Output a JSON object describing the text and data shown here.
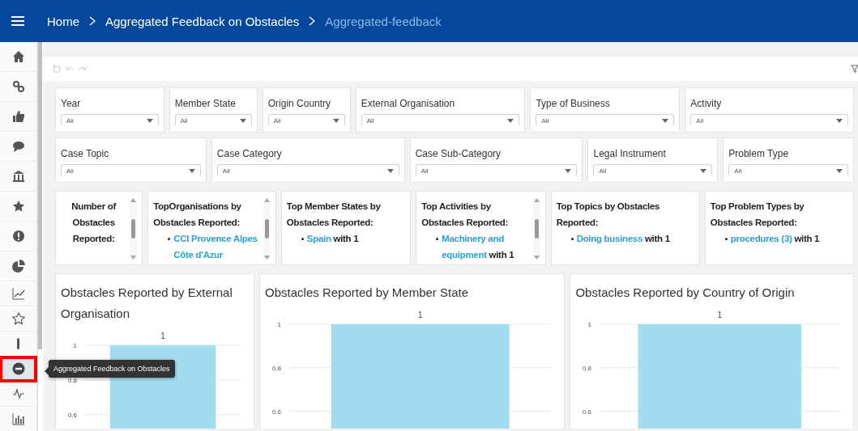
{
  "header": {
    "breadcrumb": [
      {
        "label": "Home",
        "current": false
      },
      {
        "label": "Aggregated Feedback on Obstacles",
        "current": false
      },
      {
        "label": "Aggregated-feedback",
        "current": true
      }
    ]
  },
  "sidebar": {
    "items": [
      {
        "kind": "home",
        "selected": false,
        "highlighted": false
      },
      {
        "kind": "link",
        "selected": false,
        "highlighted": false
      },
      {
        "kind": "thumbs",
        "selected": false,
        "highlighted": false
      },
      {
        "kind": "chat",
        "selected": false,
        "highlighted": false
      },
      {
        "kind": "bank",
        "selected": false,
        "highlighted": false
      },
      {
        "kind": "star",
        "selected": false,
        "highlighted": false
      },
      {
        "kind": "alert",
        "selected": false,
        "highlighted": false
      },
      {
        "kind": "pie",
        "selected": false,
        "highlighted": false
      },
      {
        "kind": "line",
        "selected": false,
        "highlighted": false
      },
      {
        "kind": "star-outline",
        "selected": false,
        "highlighted": false
      },
      {
        "kind": "thermo",
        "selected": false,
        "highlighted": false
      },
      {
        "kind": "minus",
        "selected": true,
        "highlighted": true
      },
      {
        "kind": "pulse",
        "selected": false,
        "highlighted": false
      },
      {
        "kind": "bars",
        "selected": false,
        "highlighted": false
      }
    ],
    "tooltip": "Aggregated Feedback on Obstacles"
  },
  "filters": [
    [
      {
        "label": "Year",
        "value": "All"
      },
      {
        "label": "Member State",
        "value": "All"
      },
      {
        "label": "Origin Country",
        "value": "All"
      },
      {
        "label": "External Organisation",
        "value": "All"
      },
      {
        "label": "Type of Business",
        "value": "All"
      },
      {
        "label": "Activity",
        "value": "All"
      }
    ],
    [
      {
        "label": "Case Topic",
        "value": "All"
      },
      {
        "label": "Case Category",
        "value": "All"
      },
      {
        "label": "Case Sub-Category",
        "value": "All"
      },
      {
        "label": "Legal Instrument",
        "value": "All"
      },
      {
        "label": "Problem Type",
        "value": "All"
      }
    ]
  ],
  "kpis": [
    {
      "kind": "count",
      "title": "Number of Obstacles Reported:",
      "scrollable": true
    },
    {
      "kind": "list",
      "title": "TopOrganisations by Obstacles Reported:",
      "scrollable": true,
      "items": [
        {
          "link": "CCI Provence Alpes Côte d'Azur"
        }
      ]
    },
    {
      "kind": "list",
      "title": "Top  Member States by Obstacles Reported:",
      "scrollable": false,
      "items": [
        {
          "link": "Spain",
          "text": "with 1"
        }
      ]
    },
    {
      "kind": "list",
      "title": "Top  Activities by Obstacles Reported:",
      "scrollable": true,
      "items": [
        {
          "link": "Machinery and equipment",
          "text": "with 1"
        }
      ]
    },
    {
      "kind": "list",
      "title": "Top  Topics by Obstacles Reported:",
      "scrollable": false,
      "items": [
        {
          "link": "Doing business",
          "text": "with 1"
        }
      ]
    },
    {
      "kind": "list",
      "title": "Top Problem Types by Obstacles Reported:",
      "scrollable": false,
      "items": [
        {
          "link": "procedures (3)",
          "text": "with 1"
        }
      ]
    }
  ],
  "charts": [
    {
      "title": "Obstacles Reported by External Organisation",
      "chart_data": {
        "type": "bar",
        "values": [
          1
        ],
        "ylim": [
          0.52,
          1
        ],
        "yticks": [
          0.6,
          0.8,
          1
        ],
        "data_labels": true
      }
    },
    {
      "title": "Obstacles Reported by Member State",
      "chart_data": {
        "type": "bar",
        "values": [
          1
        ],
        "ylim": [
          0.52,
          1
        ],
        "yticks": [
          0.6,
          0.8,
          1
        ],
        "data_labels": true
      }
    },
    {
      "title": "Obstacles Reported by Country of Origin",
      "chart_data": {
        "type": "bar",
        "values": [
          1
        ],
        "ylim": [
          0.52,
          1
        ],
        "yticks": [
          0.6,
          0.8,
          1
        ],
        "data_labels": true
      }
    }
  ]
}
